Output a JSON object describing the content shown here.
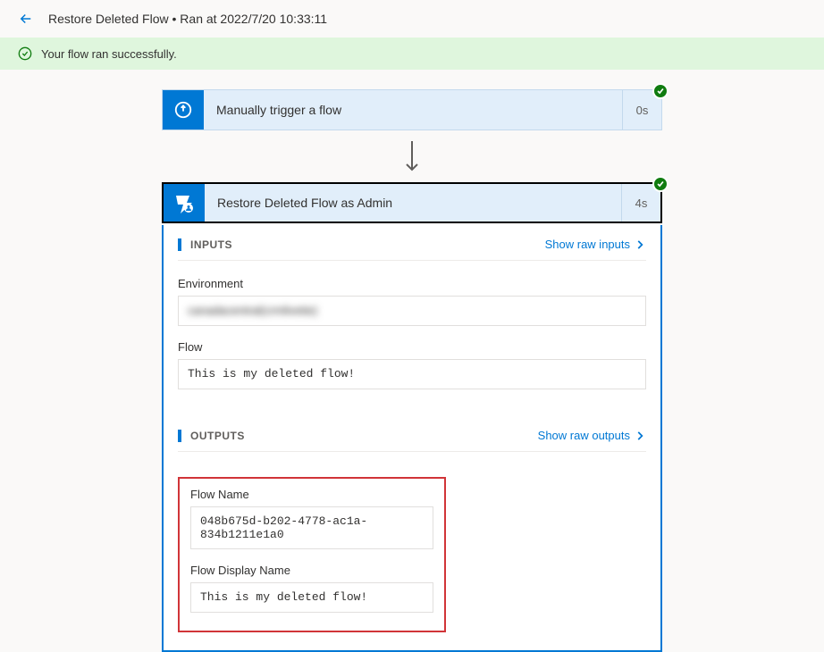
{
  "header": {
    "title": "Restore Deleted Flow • Ran at 2022/7/20 10:33:11"
  },
  "banner": {
    "message": "Your flow ran successfully."
  },
  "trigger": {
    "label": "Manually trigger a flow",
    "duration": "0s"
  },
  "action": {
    "label": "Restore Deleted Flow as Admin",
    "duration": "4s",
    "inputs_title": "INPUTS",
    "outputs_title": "OUTPUTS",
    "show_raw_inputs": "Show raw inputs",
    "show_raw_outputs": "Show raw outputs",
    "inputs": {
      "environment_label": "Environment",
      "environment_value": "canadacentral(crmlivetie)",
      "flow_label": "Flow",
      "flow_value": "This is my deleted flow!"
    },
    "outputs": {
      "flow_name_label": "Flow Name",
      "flow_name_value": "048b675d-b202-4778-ac1a-834b1211e1a0",
      "flow_display_name_label": "Flow Display Name",
      "flow_display_name_value": "This is my deleted flow!"
    }
  }
}
